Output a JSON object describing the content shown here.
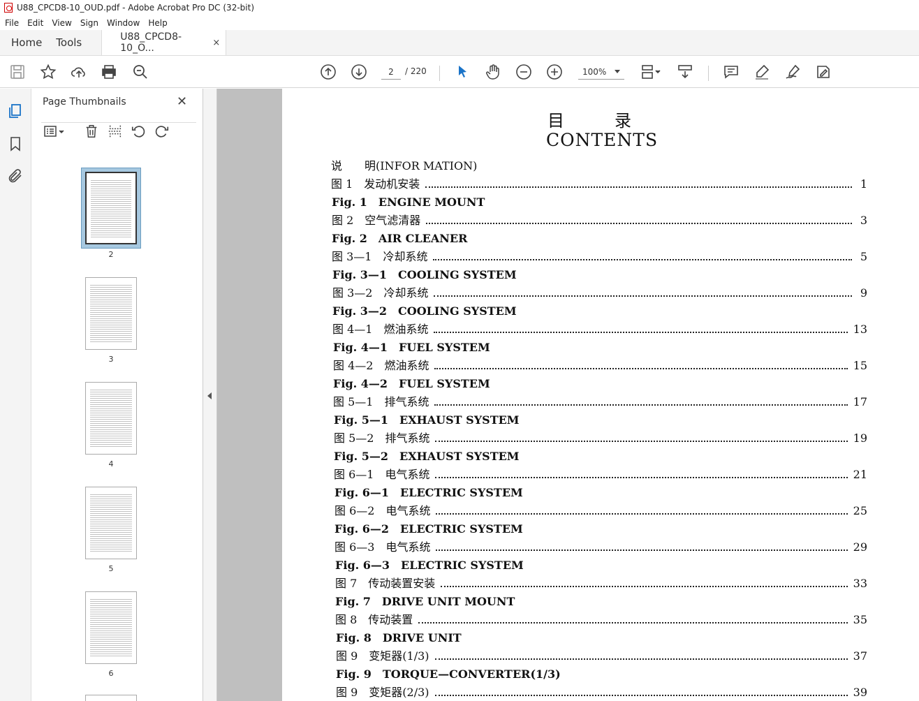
{
  "window": {
    "title": "U88_CPCD8-10_OUD.pdf - Adobe Acrobat Pro DC (32-bit)"
  },
  "menu": [
    "File",
    "Edit",
    "View",
    "Sign",
    "Window",
    "Help"
  ],
  "tabs": {
    "home": "Home",
    "tools": "Tools",
    "document": "U88_CPCD8-10_O...",
    "close_glyph": "×"
  },
  "toolbar": {
    "current_page": "2",
    "page_total": "/ 220",
    "zoom": "100%",
    "icons": [
      "save-icon",
      "star-icon",
      "upload-icon",
      "print-icon",
      "zoom-search-icon",
      "page-up-icon",
      "page-down-icon",
      "select-cursor-icon",
      "hand-icon",
      "zoom-out-icon",
      "zoom-in-icon",
      "page-layout-icon",
      "scroll-mode-icon",
      "comment-icon",
      "highlight-icon",
      "sign-icon",
      "edit-icon"
    ]
  },
  "left_rail": {
    "icons": [
      "pages-icon",
      "bookmark-icon",
      "attachment-icon"
    ]
  },
  "thumbnail_panel": {
    "title": "Page Thumbnails",
    "close_glyph": "✕",
    "thumbnails": [
      {
        "label": "2",
        "selected": true
      },
      {
        "label": "3",
        "selected": false
      },
      {
        "label": "4",
        "selected": false
      },
      {
        "label": "5",
        "selected": false
      },
      {
        "label": "6",
        "selected": false
      }
    ]
  },
  "document": {
    "title_cn": "目录",
    "title_en": "CONTENTS",
    "entries": [
      {
        "label": "说　　明(INFOR MATION)",
        "page": "",
        "dots": false,
        "en": false
      },
      {
        "label": "图 1　发动机安装",
        "page": "1",
        "dots": true,
        "en": false
      },
      {
        "label": "Fig. 1　ENGINE MOUNT",
        "page": "",
        "dots": false,
        "en": true
      },
      {
        "label": "图 2　空气滤清器",
        "page": "3",
        "dots": true,
        "en": false
      },
      {
        "label": "Fig. 2　AIR CLEANER",
        "page": "",
        "dots": false,
        "en": true
      },
      {
        "label": "图 3—1　冷却系统",
        "page": "5",
        "dots": true,
        "en": false
      },
      {
        "label": "Fig. 3—1　COOLING SYSTEM",
        "page": "",
        "dots": false,
        "en": true
      },
      {
        "label": "图 3—2　冷却系统",
        "page": "9",
        "dots": true,
        "en": false
      },
      {
        "label": "Fig. 3—2　COOLING SYSTEM",
        "page": "",
        "dots": false,
        "en": true
      },
      {
        "label": "图 4—1　燃油系统",
        "page": "13",
        "dots": true,
        "en": false
      },
      {
        "label": "Fig. 4—1　FUEL SYSTEM",
        "page": "",
        "dots": false,
        "en": true
      },
      {
        "label": "图 4—2　燃油系统",
        "page": "15",
        "dots": true,
        "en": false
      },
      {
        "label": "Fig. 4—2　FUEL SYSTEM",
        "page": "",
        "dots": false,
        "en": true
      },
      {
        "label": "图 5—1　排气系统",
        "page": "17",
        "dots": true,
        "en": false
      },
      {
        "label": "Fig. 5—1　EXHAUST SYSTEM",
        "page": "",
        "dots": false,
        "en": true
      },
      {
        "label": "图 5—2　排气系统",
        "page": "19",
        "dots": true,
        "en": false
      },
      {
        "label": "Fig. 5—2　EXHAUST SYSTEM",
        "page": "",
        "dots": false,
        "en": true
      },
      {
        "label": "图 6—1　电气系统",
        "page": "21",
        "dots": true,
        "en": false
      },
      {
        "label": "Fig. 6—1　ELECTRIC SYSTEM",
        "page": "",
        "dots": false,
        "en": true
      },
      {
        "label": "图 6—2　电气系统",
        "page": "25",
        "dots": true,
        "en": false
      },
      {
        "label": "Fig. 6—2　ELECTRIC SYSTEM",
        "page": "",
        "dots": false,
        "en": true
      },
      {
        "label": "图 6—3　电气系统",
        "page": "29",
        "dots": true,
        "en": false
      },
      {
        "label": "Fig. 6—3　ELECTRIC SYSTEM",
        "page": "",
        "dots": false,
        "en": true
      },
      {
        "label": "图 7　传动装置安装",
        "page": "33",
        "dots": true,
        "en": false
      },
      {
        "label": "Fig. 7　DRIVE UNIT MOUNT",
        "page": "",
        "dots": false,
        "en": true
      },
      {
        "label": "图 8　传动装置",
        "page": "35",
        "dots": true,
        "en": false
      },
      {
        "label": "Fig. 8　DRIVE UNIT",
        "page": "",
        "dots": false,
        "en": true
      },
      {
        "label": "图 9　变矩器(1/3)",
        "page": "37",
        "dots": true,
        "en": false
      },
      {
        "label": "Fig. 9　TORQUE—CONVERTER(1/3)",
        "page": "",
        "dots": false,
        "en": true
      },
      {
        "label": "图 9　变矩器(2/3)",
        "page": "39",
        "dots": true,
        "en": false
      }
    ]
  }
}
